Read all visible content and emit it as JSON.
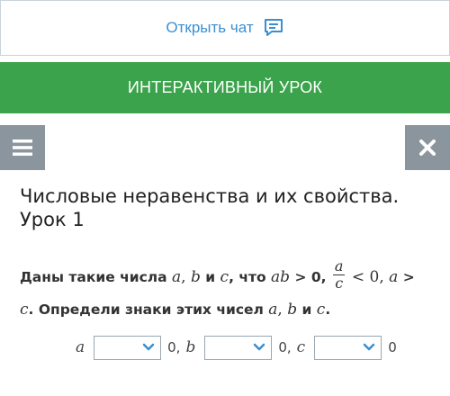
{
  "chat": {
    "label": "Открыть чат",
    "icon": "chat-icon"
  },
  "banner": {
    "title": "ИНТЕРАКТИВНЫЙ УРОК"
  },
  "toolbar": {
    "menu_icon": "menu-icon",
    "close_icon": "close-icon"
  },
  "lesson": {
    "title": "Числовые неравенства и их свойства. Урок 1"
  },
  "task": {
    "t1": "Даны такие числа ",
    "v_a": "a",
    "c1": ", ",
    "v_b": "b",
    "t_and1": " и ",
    "v_c": "c",
    "t_that": ", что ",
    "v_ab": "ab",
    "t_gt0": " > 0, ",
    "frac_num": "a",
    "frac_den": "c",
    "t_lt0": " < 0, ",
    "v_a2": "a",
    "t_gt": " >",
    "v_c2": "c",
    "t_det": ". Определи знаки этих чисел ",
    "v_a3": "a",
    "c2": ", ",
    "v_b3": "b",
    "t_and2": " и ",
    "v_c3": "c",
    "t_end": "."
  },
  "answers": [
    {
      "var": "a",
      "selected": "",
      "after": "0,"
    },
    {
      "var": "b",
      "selected": "",
      "after": "0,"
    },
    {
      "var": "c",
      "selected": "",
      "after": "0"
    }
  ],
  "colors": {
    "banner": "#3aa34b",
    "chat_text": "#3a8fd0",
    "buttons": "#8a959e",
    "chevron": "#3a8fd0"
  }
}
